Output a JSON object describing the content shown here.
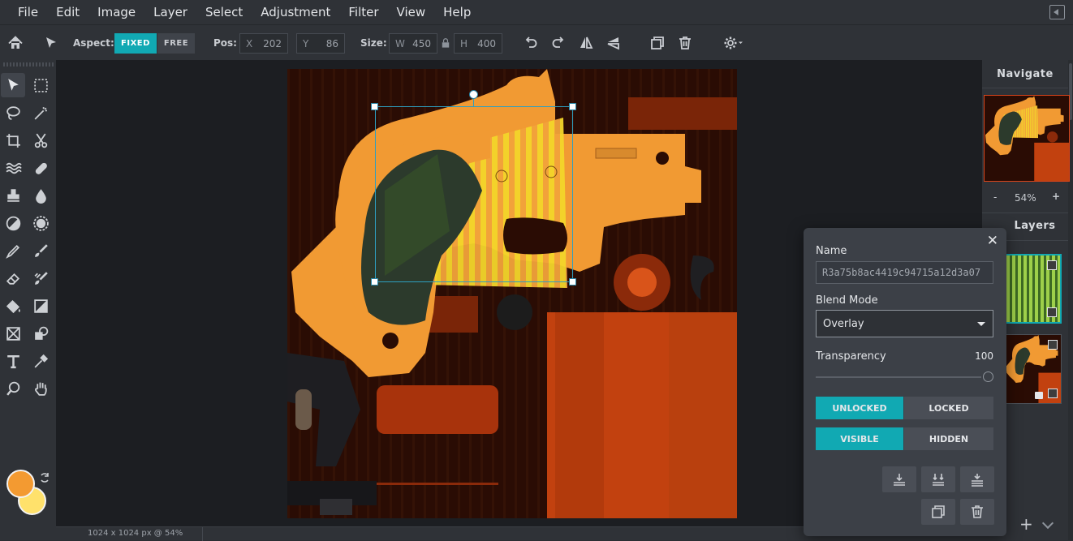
{
  "menubar": {
    "items": [
      "File",
      "Edit",
      "Image",
      "Layer",
      "Select",
      "Adjustment",
      "Filter",
      "View",
      "Help"
    ]
  },
  "toolbar": {
    "aspect_label": "Aspect:",
    "fixed_label": "FIXED",
    "free_label": "FREE",
    "pos_label": "Pos:",
    "x_label": "X",
    "x_value": "202",
    "y_label": "Y",
    "y_value": "86",
    "size_label": "Size:",
    "w_label": "W",
    "w_value": "450",
    "h_label": "H",
    "h_value": "400",
    "accent_color": "#11a9b3",
    "icons": [
      "home-icon",
      "move-tool-icon",
      "lock-icon",
      "undo-icon",
      "redo-icon",
      "flip-horizontal-icon",
      "flip-vertical-icon",
      "duplicate-icon",
      "trash-icon",
      "gear-icon"
    ]
  },
  "tools": [
    "move",
    "rect-select",
    "lasso",
    "magic-wand",
    "crop",
    "cut",
    "liquify",
    "bandage",
    "clone-stamp",
    "blur",
    "dodge",
    "sponge",
    "pen",
    "brush",
    "eraser",
    "color-replace",
    "fill",
    "gradient",
    "frame",
    "shapes",
    "text",
    "eyedropper",
    "zoom",
    "hand"
  ],
  "colors": {
    "foreground": "#f39a31",
    "background": "#ffe16b"
  },
  "status": {
    "text": "1024 x 1024 px @ 54%"
  },
  "navigate": {
    "title": "Navigate",
    "zoom_value": "54%",
    "zoom_out": "-",
    "zoom_in": "+"
  },
  "layers": {
    "title": "Layers"
  },
  "layer_props": {
    "name_label": "Name",
    "name_value": "R3a75b8ac4419c94715a12d3a07",
    "blend_label": "Blend Mode",
    "blend_value": "Overlay",
    "transparency_label": "Transparency",
    "transparency_value": "100",
    "unlocked_label": "UNLOCKED",
    "locked_label": "LOCKED",
    "visible_label": "VISIBLE",
    "hidden_label": "HIDDEN",
    "close_glyph": "✕"
  }
}
